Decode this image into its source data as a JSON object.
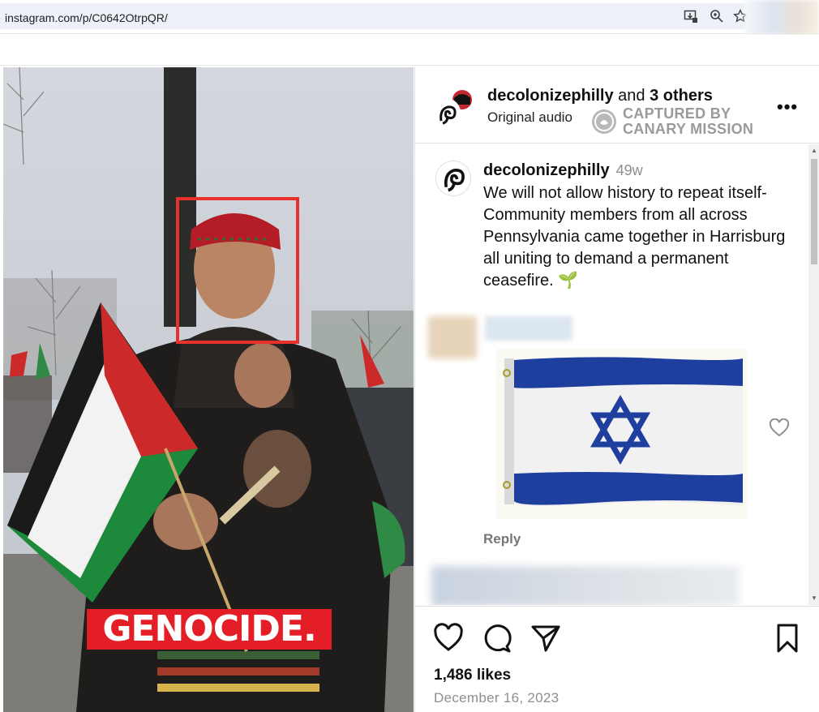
{
  "browser": {
    "url": "instagram.com/p/C0642OtrpQR/"
  },
  "video": {
    "overlay_caption": "GENOCIDE."
  },
  "header": {
    "username": "decolonizephilly",
    "others_prefix": "and",
    "others": "3 others",
    "audio": "Original audio",
    "more": "•••"
  },
  "watermark": {
    "line1": "CAPTURED BY",
    "line2": "CANARY MISSION"
  },
  "caption": {
    "username": "decolonizephilly",
    "time": "49w",
    "text": "We will not allow history to repeat itself- Community members from all across Pennsylvania came together in Harrisburg all uniting to demand a permanent ceasefire. 🌱"
  },
  "comment": {
    "reply_label": "Reply"
  },
  "actions": {
    "likes": "1,486 likes",
    "date": "December 16, 2023"
  },
  "colors": {
    "accent_red": "#e41e26",
    "flag_blue": "#1f3f9f",
    "muted_text": "#8e8e8e"
  }
}
